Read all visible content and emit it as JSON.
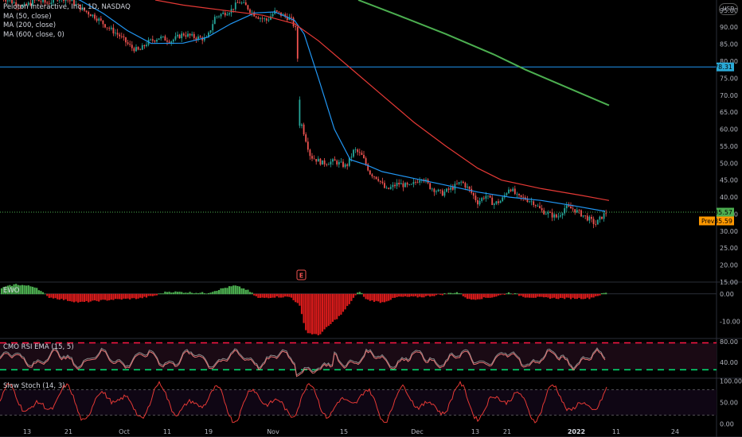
{
  "header": {
    "symbol_line": "Peloton Interactive, Inc., 1D, NASDAQ",
    "indicators": [
      "MA (50, close)",
      "MA (200, close)",
      "MA (600, close, 0)"
    ],
    "currency_label": "USD"
  },
  "colors": {
    "up": "#26a69a",
    "down": "#ef5350",
    "ma50": "#2196f3",
    "ma200": "#e53935",
    "ma600": "#4caf50",
    "hline": "#2196f3",
    "price_badge": "#4caf50",
    "prev_badge": "#ff9800"
  },
  "chart_data": [
    {
      "type": "candlestick",
      "title": "Peloton Interactive, Inc., 1D, NASDAQ",
      "y_ticks": [
        95,
        90,
        85,
        80,
        75,
        70,
        65,
        60,
        55,
        50,
        45,
        40,
        35,
        30,
        25,
        20,
        15
      ],
      "ylim": [
        15,
        98
      ],
      "x_ticks": [
        "13",
        "21",
        "Oct",
        "11",
        "19",
        "Nov",
        "15",
        "Dec",
        "13",
        "21",
        "2022",
        "11",
        "24"
      ],
      "price_badges": {
        "last": "35.57",
        "marker": "78.31",
        "prev_label": "Prev",
        "prev_value": "35.59"
      },
      "horizontal_line": 78.31,
      "event_marker": "E",
      "series": [
        {
          "name": "MA (50, close)",
          "type": "line",
          "points": [
            [
              0,
              99
            ],
            [
              60,
              101
            ],
            [
              100,
              98
            ],
            [
              130,
              94
            ],
            [
              160,
              89
            ],
            [
              190,
              85.2
            ],
            [
              230,
              85.3
            ],
            [
              260,
              87
            ],
            [
              290,
              91
            ],
            [
              320,
              94.2
            ],
            [
              345,
              94.5
            ],
            [
              370,
              92
            ],
            [
              382,
              88
            ],
            [
              400,
              75
            ],
            [
              420,
              60
            ],
            [
              440,
              51
            ],
            [
              460,
              49.5
            ],
            [
              480,
              47.5
            ],
            [
              500,
              46.5
            ],
            [
              530,
              45
            ],
            [
              560,
              43.5
            ],
            [
              600,
              41.5
            ],
            [
              640,
              40
            ],
            [
              680,
              39
            ],
            [
              720,
              37.5
            ],
            [
              760,
              35.8
            ]
          ]
        },
        {
          "name": "MA (200, close)",
          "type": "line",
          "points": [
            [
              195,
              98
            ],
            [
              230,
              96.5
            ],
            [
              280,
              95
            ],
            [
              330,
              93.5
            ],
            [
              370,
              91
            ],
            [
              400,
              86
            ],
            [
              440,
              78
            ],
            [
              480,
              70
            ],
            [
              520,
              62
            ],
            [
              560,
              55
            ],
            [
              600,
              48.5
            ],
            [
              630,
              45
            ],
            [
              680,
              42.5
            ],
            [
              730,
              40.5
            ],
            [
              765,
              39
            ]
          ]
        },
        {
          "name": "MA (600, close, 0)",
          "type": "line",
          "points": [
            [
              450,
              98
            ],
            [
              500,
              93.5
            ],
            [
              560,
              88
            ],
            [
              620,
              82
            ],
            [
              660,
              77.5
            ],
            [
              700,
              73.5
            ],
            [
              735,
              70
            ],
            [
              765,
              67
            ]
          ]
        },
        {
          "name": "Price",
          "type": "candlestick-path",
          "points": [
            [
              0,
              99
            ],
            [
              15,
              97.5
            ],
            [
              30,
              96
            ],
            [
              45,
              98
            ],
            [
              60,
              97
            ],
            [
              75,
              99
            ],
            [
              90,
              97.5
            ],
            [
              105,
              95
            ],
            [
              120,
              93
            ],
            [
              135,
              90
            ],
            [
              150,
              87.5
            ],
            [
              165,
              84
            ],
            [
              175,
              83
            ],
            [
              185,
              85.5
            ],
            [
              200,
              87
            ],
            [
              215,
              86
            ],
            [
              230,
              88
            ],
            [
              245,
              87
            ],
            [
              260,
              86.5
            ],
            [
              270,
              93
            ],
            [
              280,
              94
            ],
            [
              290,
              95
            ],
            [
              300,
              97.5
            ],
            [
              310,
              96
            ],
            [
              318,
              94
            ],
            [
              325,
              93
            ],
            [
              335,
              92
            ],
            [
              345,
              94.5
            ],
            [
              355,
              93.5
            ],
            [
              365,
              92.5
            ],
            [
              372,
              89
            ],
            [
              378,
              62
            ],
            [
              383,
              58
            ],
            [
              390,
              52
            ],
            [
              405,
              50
            ],
            [
              420,
              50.5
            ],
            [
              435,
              49
            ],
            [
              445,
              54
            ],
            [
              455,
              52
            ],
            [
              465,
              47
            ],
            [
              475,
              45.5
            ],
            [
              485,
              42
            ],
            [
              500,
              44
            ],
            [
              515,
              43
            ],
            [
              530,
              46
            ],
            [
              540,
              43
            ],
            [
              555,
              41
            ],
            [
              570,
              43
            ],
            [
              580,
              44.5
            ],
            [
              590,
              42
            ],
            [
              600,
              38.5
            ],
            [
              610,
              40.5
            ],
            [
              620,
              38
            ],
            [
              630,
              39
            ],
            [
              640,
              43
            ],
            [
              650,
              40
            ],
            [
              660,
              39.5
            ],
            [
              670,
              38.5
            ],
            [
              680,
              36
            ],
            [
              690,
              35
            ],
            [
              700,
              34
            ],
            [
              710,
              37
            ],
            [
              720,
              36.5
            ],
            [
              730,
              35
            ],
            [
              740,
              33.5
            ],
            [
              748,
              32
            ],
            [
              755,
              34
            ],
            [
              762,
              35.57
            ]
          ]
        }
      ]
    },
    {
      "type": "histogram",
      "title": "EWO",
      "y_ticks": [
        "0.00",
        "-10.00"
      ],
      "ylim": [
        -16,
        4
      ]
    },
    {
      "type": "line",
      "title": "CMO RSI EMA (15, 5)",
      "y_ticks": [
        "80.00",
        "40.00"
      ],
      "ylim": [
        10,
        85
      ],
      "levels": [
        78,
        25
      ]
    },
    {
      "type": "line",
      "title": "Slow Stoch (14, 3)",
      "y_ticks": [
        "100.00",
        "50.00",
        "0.00"
      ],
      "ylim": [
        -5,
        105
      ],
      "levels": [
        80,
        20
      ]
    }
  ]
}
